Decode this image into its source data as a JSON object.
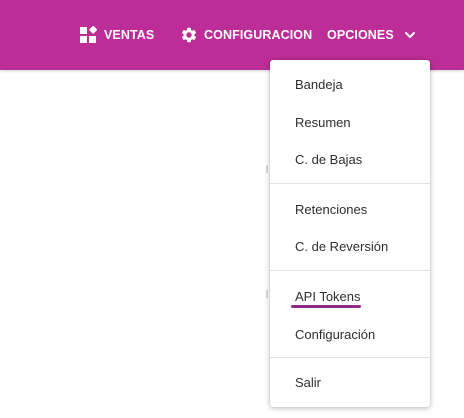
{
  "nav": {
    "ventas": {
      "label": "VENTAS",
      "icon": "dashboard-icon"
    },
    "configuracion": {
      "label": "CONFIGURACION",
      "icon": "gear-icon"
    },
    "opciones": {
      "label": "OPCIONES",
      "icon": "chevron-down-icon"
    }
  },
  "menu": {
    "items": [
      {
        "label": "Bandeja"
      },
      {
        "label": "Resumen"
      },
      {
        "label": "C. de Bajas"
      },
      {
        "label": "Retenciones"
      },
      {
        "label": "C. de Reversión"
      },
      {
        "label": "API Tokens"
      },
      {
        "label": "Configuración"
      },
      {
        "label": "Salir"
      }
    ]
  },
  "colors": {
    "topbar": "#bd2d98",
    "underline": "#8e2a8e",
    "menu_text": "#2e2e2e"
  }
}
